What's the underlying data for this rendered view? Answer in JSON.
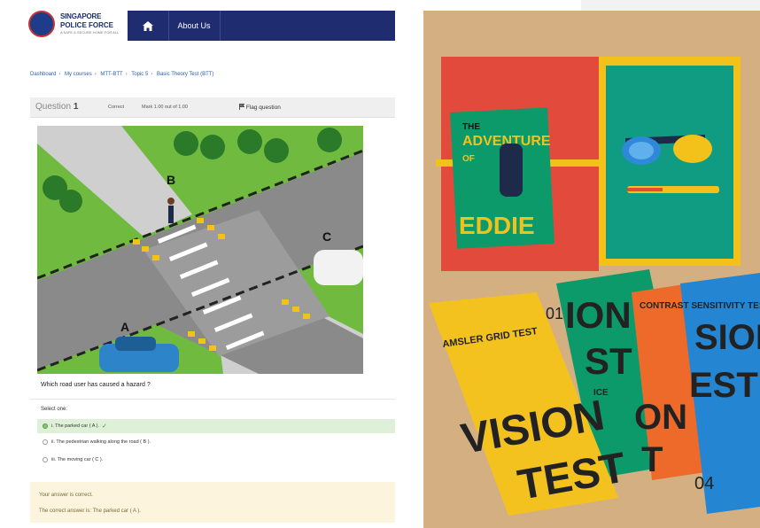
{
  "header": {
    "logo_line1": "SINGAPORE",
    "logo_line2": "POLICE FORCE",
    "logo_line3": "A SAFE & SECURE HOME FOR ALL",
    "home_icon": "home-icon",
    "nav_about": "About Us",
    "nav_color": "#1f2d70"
  },
  "breadcrumb": [
    "Dashboard",
    "My courses",
    "MTT-BTT",
    "Topic 5",
    "Basic Theory Test (BTT)"
  ],
  "question": {
    "label": "Question",
    "number": "1",
    "state": "Correct",
    "mark": "Mark 1.00 out of 1.00",
    "flag": "Flag question",
    "flag_icon": "flag-icon",
    "prompt": "Which road user has caused a hazard ?",
    "scene_labels": {
      "a": "A",
      "b": "B",
      "c": "C"
    }
  },
  "answer": {
    "select_label": "Select one:",
    "options": [
      {
        "text": "i. The parked car ( A ).",
        "correct": true
      },
      {
        "text": "ii. The pedestrian walking along the road ( B ).",
        "correct": false
      },
      {
        "text": "iii. The moving car ( C ).",
        "correct": false
      }
    ]
  },
  "feedback": {
    "line1": "Your answer is correct.",
    "line2": "The correct answer is:  The parked car ( A )."
  },
  "photo": {
    "book_line1": "THE",
    "book_line2": "ADVENTURE",
    "book_line3": "OF",
    "book_line4": "EDDIE",
    "card1_title": "AMSLER GRID TEST",
    "card1_num": "01",
    "card1_big1": "VISION",
    "card1_big2": "TEST",
    "card2_frag1": "ION",
    "card2_frag2": "ST",
    "card2_frag3": "ICE",
    "card3_title": "CONTRAST SENSITIVITY TEST",
    "card3_frag1": "ON",
    "card3_frag2": "T",
    "card4_frag1": "SION",
    "card4_frag2": "EST",
    "card4_num": "04",
    "colors": {
      "yellow": "#f4c21f",
      "green": "#0d9a6a",
      "orange": "#ee6a2a",
      "blue": "#2486d2",
      "red": "#e0463a",
      "teal": "#0f9c82"
    }
  }
}
